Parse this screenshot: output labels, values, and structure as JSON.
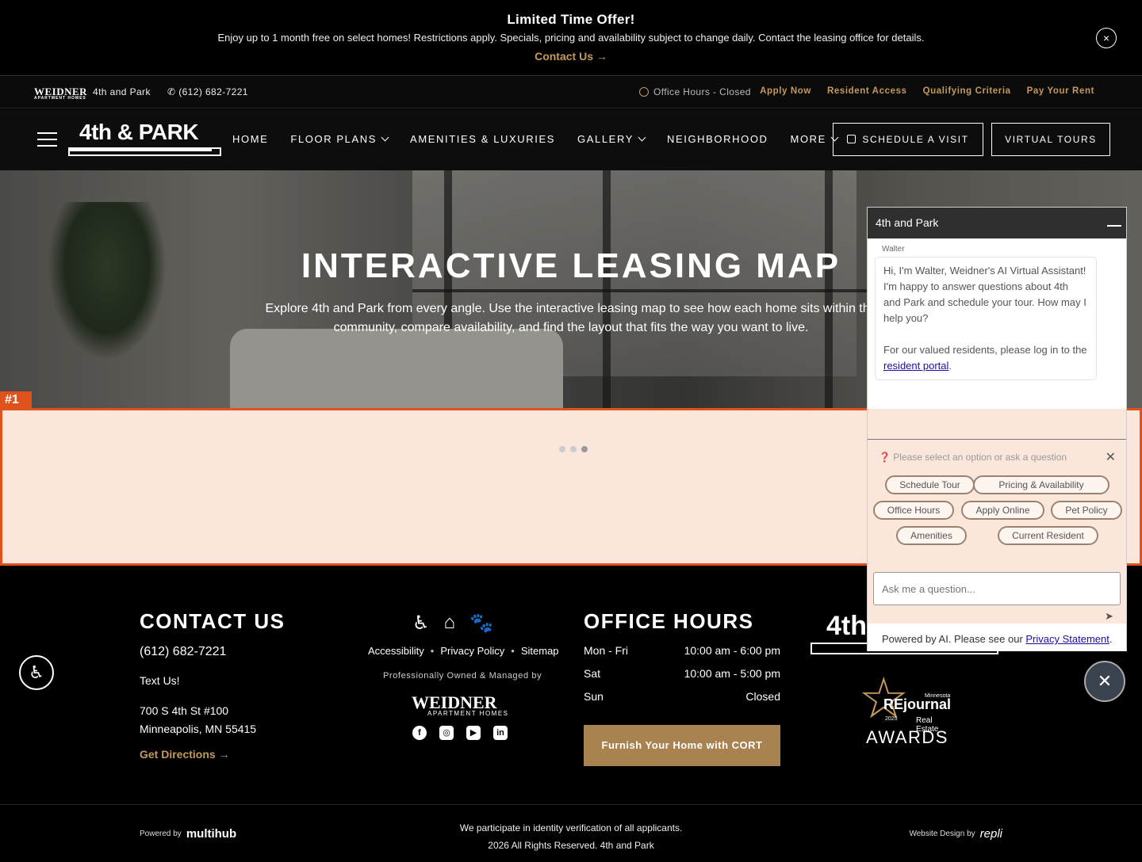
{
  "promo": {
    "title": "Limited Time Offer!",
    "text": "Enjoy up to 1 month free on select homes! Restrictions apply. Specials, pricing and availability subject to change daily. Contact the leasing office for details.",
    "link": "Contact Us →",
    "close_icon": "×"
  },
  "utility": {
    "logo": "WEIDNER",
    "logo_sub": "APARTMENT HOMES",
    "property": "4th and Park",
    "phone": "(612) 682-7221",
    "hours": "Office Hours - Closed",
    "links": [
      "Apply Now",
      "Resident Access",
      "Qualifying Criteria",
      "Pay Your Rent"
    ]
  },
  "nav": {
    "brand": "4th & PARK",
    "links": [
      "HOME",
      "FLOOR PLANS",
      "AMENITIES & LUXURIES",
      "GALLERY",
      "NEIGHBORHOOD",
      "MORE"
    ],
    "schedule": "SCHEDULE A VISIT",
    "tours": "VIRTUAL TOURS"
  },
  "hero": {
    "title": "INTERACTIVE LEASING MAP",
    "description": "Explore 4th and Park from every angle. Use the interactive leasing map to see how each home sits within the community, compare availability, and find the layout that fits the way you want to live."
  },
  "map": {
    "badge": "#1"
  },
  "footer": {
    "contact_heading": "CONTACT US",
    "phone": "(612) 682-7221",
    "text_us": "Text Us!",
    "address_line1": "700 S 4th St #100",
    "address_line2": "Minneapolis, MN 55415",
    "directions": "Get Directions →",
    "links": [
      "Accessibility",
      "Privacy Policy",
      "Sitemap"
    ],
    "managed_by": "Professionally Owned & Managed by",
    "weidner": "WEIDNER",
    "weidner_sub": "APARTMENT HOMES",
    "hours_heading": "OFFICE HOURS",
    "hours": [
      {
        "day": "Mon - Fri",
        "time": "10:00 am - 6:00 pm"
      },
      {
        "day": "Sat",
        "time": "10:00 am - 5:00 pm"
      },
      {
        "day": "Sun",
        "time": "Closed"
      }
    ],
    "cort_button": "Furnish Your Home with CORT",
    "brand": "4th",
    "award_minnesota": "Minnesota",
    "award_re": "REjournal",
    "award_year": "2025",
    "award_real_estate": "Real Estate",
    "award_awards": "AWARDS",
    "powered_by": "Powered by",
    "powered_brand": "multihub",
    "legal_line1": "We participate in identity verification of all applicants.",
    "legal_line2": "2026 All Rights Reserved. 4th and Park",
    "design_by": "Website Design by",
    "design_brand": "repli"
  },
  "chat": {
    "title": "4th and Park",
    "sender": "Walter",
    "message1": "Hi, I'm Walter, Weidner's AI Virtual Assistant! I'm happy to answer questions about 4th and Park and schedule your tour. How may I help you?",
    "message2_prefix": "For our valued residents, please log in to the ",
    "message2_link": "resident portal",
    "message2_suffix": ".",
    "prompt": "Please select an option or ask a question",
    "options": [
      "Schedule Tour",
      "Pricing & Availability",
      "Office Hours",
      "Apply Online",
      "Pet Policy",
      "Amenities",
      "Current Resident"
    ],
    "input_placeholder": "Ask me a question...",
    "footer_prefix": "Powered by AI. Please see our ",
    "footer_link": "Privacy Statement",
    "footer_suffix": "."
  }
}
